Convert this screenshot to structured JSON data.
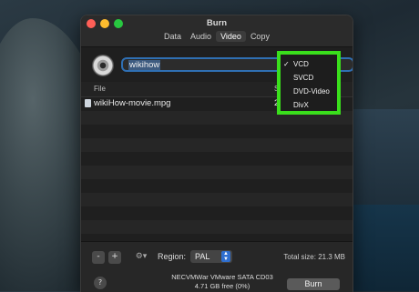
{
  "window": {
    "title": "Burn"
  },
  "tabs": [
    {
      "label": "Data",
      "active": false
    },
    {
      "label": "Audio",
      "active": false
    },
    {
      "label": "Video",
      "active": true
    },
    {
      "label": "Copy",
      "active": false
    }
  ],
  "disc_name": {
    "value": "wikihow"
  },
  "list": {
    "headers": {
      "file": "File",
      "size": "S"
    },
    "rows": [
      {
        "file": "wikiHow-movie.mpg",
        "size": "2"
      }
    ]
  },
  "bottom": {
    "remove_label": "-",
    "add_label": "+",
    "gear_label": "⚙▾",
    "region_label": "Region:",
    "region_value": "PAL",
    "total_size": "Total size: 21.3 MB",
    "help_label": "?",
    "device_name": "NECVMWar VMware SATA CD03",
    "device_free": "4.71 GB free (0%)",
    "burn_label": "Burn"
  },
  "format_menu": {
    "options": [
      {
        "label": "VCD",
        "checked": true
      },
      {
        "label": "SVCD",
        "checked": false
      },
      {
        "label": "DVD-Video",
        "checked": false
      },
      {
        "label": "DivX",
        "checked": false
      }
    ],
    "checkmark": "✓",
    "highlight_color": "#3adf1c"
  },
  "colors": {
    "close": "#ff5f57",
    "minimize": "#febc2e",
    "zoom": "#28c840",
    "focus_ring": "#2f6fb3"
  },
  "icons": {
    "disc": "disc-icon",
    "file": "movie-file-icon",
    "gear": "gear-icon"
  }
}
